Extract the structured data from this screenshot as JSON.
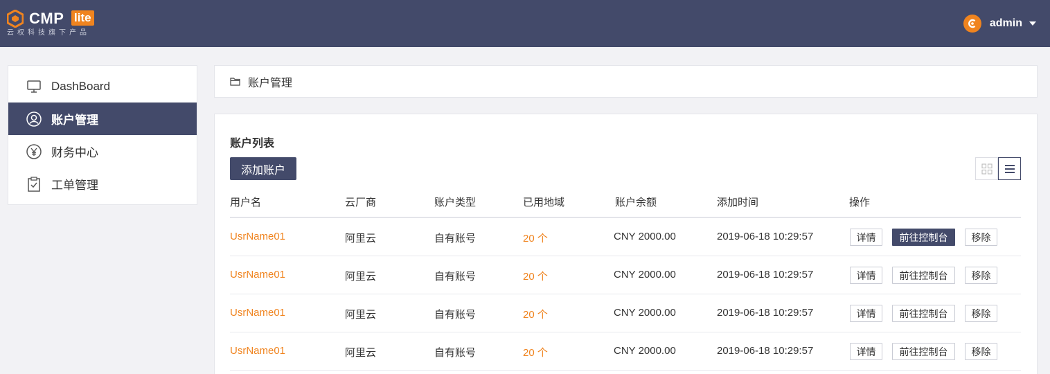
{
  "colors": {
    "header_bg": "#434a6a",
    "accent": "#f0841f",
    "primary_btn": "#434a6a"
  },
  "brand": {
    "name": "CMP",
    "badge": "lite",
    "subtitle": "云权科技旗下产品"
  },
  "user": {
    "name": "admin"
  },
  "sidebar": {
    "items": [
      {
        "label": "DashBoard",
        "icon": "monitor-icon"
      },
      {
        "label": "账户管理",
        "icon": "user-circle-icon",
        "active": true
      },
      {
        "label": "财务中心",
        "icon": "yen-circle-icon"
      },
      {
        "label": "工单管理",
        "icon": "clipboard-icon"
      }
    ]
  },
  "breadcrumb": {
    "label": "账户管理",
    "icon": "folder-icon"
  },
  "main": {
    "title": "账户列表",
    "add_button": "添加账户",
    "columns": [
      "用户名",
      "云厂商",
      "账户类型",
      "已用地域",
      "账户余额",
      "添加时间",
      "操作"
    ],
    "actions": {
      "detail": "详情",
      "console": "前往控制台",
      "remove": "移除"
    },
    "rows": [
      {
        "username": "UsrName01",
        "vendor": "阿里云",
        "type": "自有账号",
        "regions": "20 个",
        "balance": "CNY 2000.00",
        "added": "2019-06-18 10:29:57"
      },
      {
        "username": "UsrName01",
        "vendor": "阿里云",
        "type": "自有账号",
        "regions": "20 个",
        "balance": "CNY 2000.00",
        "added": "2019-06-18 10:29:57"
      },
      {
        "username": "UsrName01",
        "vendor": "阿里云",
        "type": "自有账号",
        "regions": "20 个",
        "balance": "CNY 2000.00",
        "added": "2019-06-18 10:29:57"
      },
      {
        "username": "UsrName01",
        "vendor": "阿里云",
        "type": "自有账号",
        "regions": "20 个",
        "balance": "CNY 2000.00",
        "added": "2019-06-18 10:29:57"
      }
    ]
  }
}
